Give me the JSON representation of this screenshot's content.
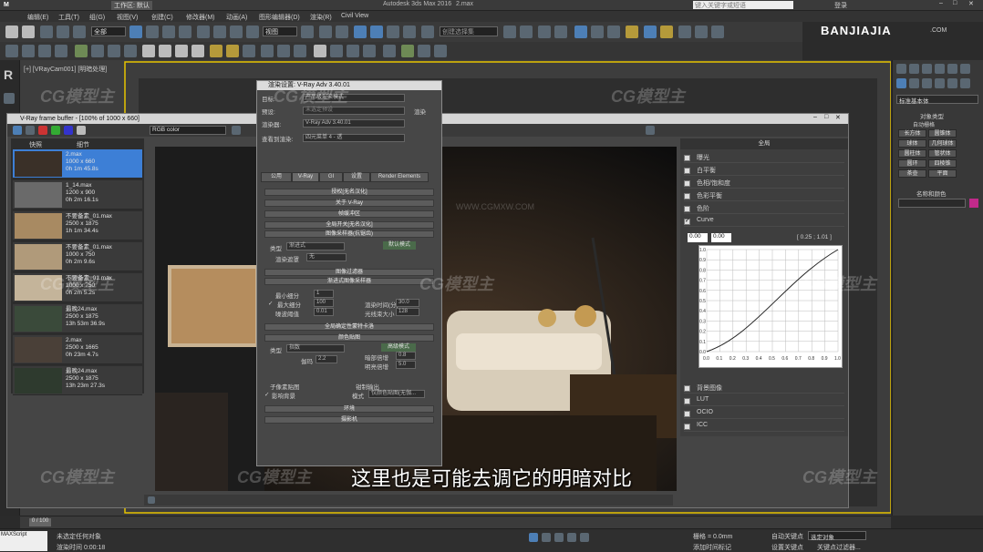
{
  "titlebar": {
    "workspace": "工作区: 默认",
    "app_title": "Autodesk 3ds Max 2016",
    "file": "2.max",
    "search_placeholder": "键入关键字或短语",
    "login": "登录"
  },
  "menu": [
    "编辑(E)",
    "工具(T)",
    "组(G)",
    "视图(V)",
    "创建(C)",
    "修改器(M)",
    "动画(A)",
    "图形编辑器(D)",
    "渲染(R)",
    "Civil View"
  ],
  "toolbar": {
    "filter_value": "全部",
    "view_value": "视图",
    "selset_placeholder": "创建选择集"
  },
  "brand": {
    "name": "BANJIAJIA",
    "suffix": ".COM"
  },
  "viewport": {
    "label": "[+] [VRayCam001] [明暗处理]"
  },
  "vfb": {
    "title": "V-Ray frame buffer - [100% of 1000 x 660]",
    "channel": "RGB color",
    "history_header": {
      "col1": "快照",
      "col2": "细节"
    },
    "history": [
      {
        "name": "2.max",
        "size": "1000 x 660",
        "time": "0h 1m 45.8s",
        "selected": true
      },
      {
        "name": "1_14.max",
        "size": "1200 x 900",
        "time": "0h 2m 16.1s",
        "selected": false
      },
      {
        "name": "不要备素_01.max",
        "size": "2500 x 1875",
        "time": "1h 1m 34.4s",
        "selected": false
      },
      {
        "name": "不要备素_01.max",
        "size": "1000 x 750",
        "time": "0h 2m 9.6s",
        "selected": false
      },
      {
        "name": "不要备素_01.max",
        "size": "1000 x 750",
        "time": "0h 2m 5.2s",
        "selected": false
      },
      {
        "name": "最晚24.max",
        "size": "2500 x 1875",
        "time": "13h 53m 36.9s",
        "selected": false
      },
      {
        "name": "2.max",
        "size": "2500 x 1665",
        "time": "0h 23m 4.7s",
        "selected": false
      },
      {
        "name": "最晚24.max",
        "size": "2500 x 1875",
        "time": "13h 23m 27.3s",
        "selected": false
      }
    ],
    "corrections_title": "全局",
    "corrections": [
      {
        "label": "曝光",
        "checked": false
      },
      {
        "label": "白平衡",
        "checked": false
      },
      {
        "label": "色相/饱和度",
        "checked": false
      },
      {
        "label": "色彩平衡",
        "checked": false
      },
      {
        "label": "色阶",
        "checked": false
      },
      {
        "label": "Curve",
        "checked": true
      }
    ],
    "curve_in": "0.00",
    "curve_out": "0.00",
    "curve_coord": "[ 0.25 ; 1.01 ]",
    "curve_ticks": [
      "0.0",
      "0.1",
      "0.2",
      "0.3",
      "0.4",
      "0.5",
      "0.6",
      "0.7",
      "0.8",
      "0.9",
      "1.0"
    ],
    "bottom_options": [
      "背景图像",
      "LUT",
      "OCIO",
      "ICC"
    ]
  },
  "render_setup": {
    "title": "渲染设置: V-Ray Adv 3.40.01",
    "target_label": "目标:",
    "target_value": "产品级渲染模式",
    "preset_label": "预设:",
    "preset_value": "未选定预设",
    "renderer_label": "渲染器:",
    "renderer_value": "V-Ray Adv 3.40.01",
    "view_label": "查看到渲染:",
    "view_value": "四元菜单 4 - 透",
    "render_button": "渲染",
    "tabs": [
      "公用",
      "V-Ray",
      "GI",
      "设置",
      "Render Elements"
    ],
    "rollouts_top": [
      "授权[无名汉化]",
      "关于 V-Ray",
      "帧缓冲区",
      "全局开关[无名汉化]",
      "图像采样器(抗锯齿)"
    ],
    "type_label": "类型",
    "type_value": "渐进式",
    "mode_label": "默认模式",
    "render_mask_label": "渲染遮罩",
    "render_mask_value": "无",
    "rollouts_mid": [
      "图像过滤器",
      "渐进式图像采样器"
    ],
    "min_sub_label": "最小细分",
    "min_sub_value": "1",
    "max_sub_label": "最大细分",
    "max_sub_value": "100",
    "noise_label": "噪波阈值",
    "noise_value": "0.01",
    "time_label": "渲染时间(分)",
    "time_value": "30.0",
    "bundle_label": "光线束大小",
    "bundle_value": "128",
    "rollouts_low": [
      "全局确定性蒙特卡洛",
      "颜色贴图"
    ],
    "cm_type_label": "类型",
    "cm_type_value": "指数",
    "cm_mode_label": "高级模式",
    "gamma_label": "伽玛",
    "gamma_value": "2.2",
    "dark_label": "暗部倍增",
    "dark_value": "0.8",
    "bright_label": "明亮倍增",
    "bright_value": "5.0",
    "sub_pixel_label": "子像素贴图",
    "clamp_label": "钳制输出",
    "affect_bg_label": "影响背景",
    "mode_label2": "模式",
    "mode_value2": "仅颜色贴图(无伽...",
    "rollouts_bottom": [
      "环境",
      "摄影机"
    ]
  },
  "command_panel": {
    "dropdown": "标准基本体",
    "section": "对象类型",
    "autogrid": "自动栅格",
    "objects": [
      "长方体",
      "圆锥体",
      "球体",
      "几何球体",
      "圆柱体",
      "管状体",
      "圆环",
      "四棱锥",
      "茶壶",
      "平面"
    ],
    "name_color": "名称和颜色"
  },
  "subtitle": "这里也是可能去调它的明暗对比",
  "status": {
    "selected": "未选定任何对象",
    "render_time": "渲染时间 0:00:18",
    "grid": "栅格 = 0.0mm",
    "auto_key": "自动关键点",
    "selected_obj": "选定对象",
    "set_key": "设置关键点",
    "key_filters": "关键点过滤器...",
    "add_time_tag": "添加时间标记",
    "frame": "0 / 100",
    "max_label": "MAXScript"
  },
  "watermarks": [
    "CG模型主",
    "CG模型主",
    "CG模型主",
    "CG模型主",
    "CG模型主",
    "CG模型主",
    "CG模型主",
    "CG模型主",
    "CG模型主"
  ],
  "watermark_url": "WWW.CGMXW.COM"
}
